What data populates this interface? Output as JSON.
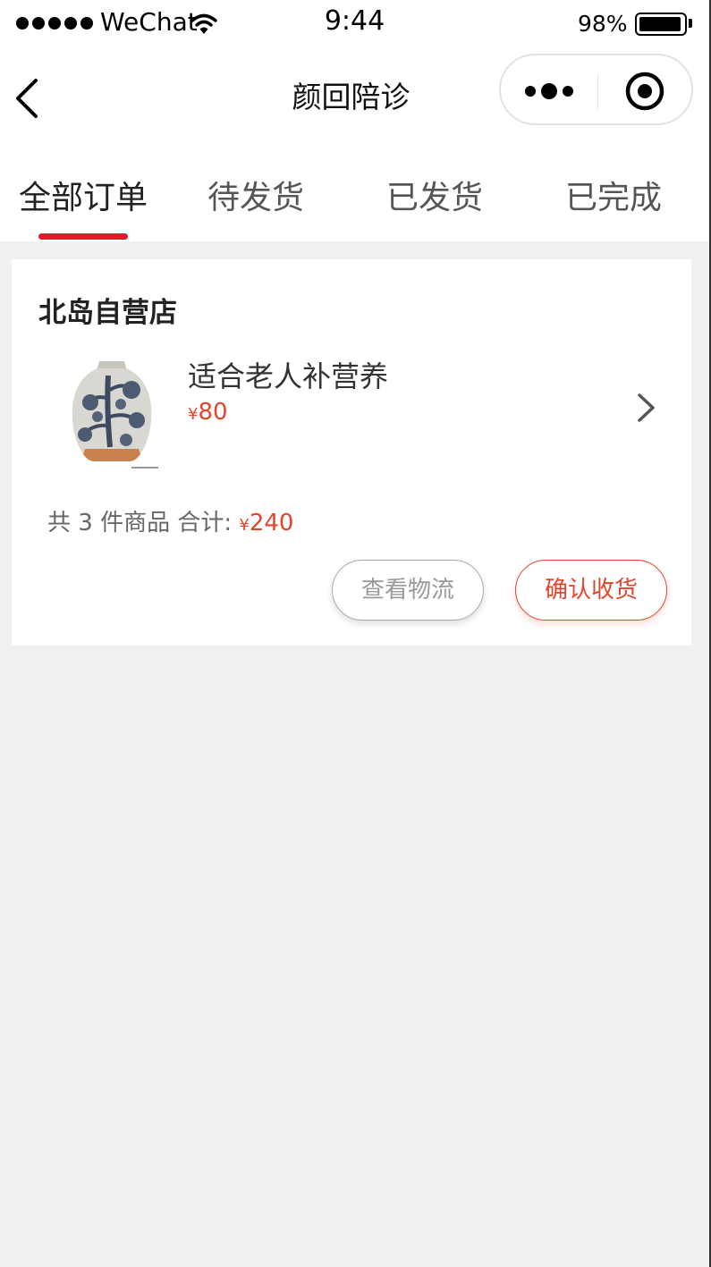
{
  "status_bar": {
    "carrier": "WeChat",
    "time": "9:44",
    "battery": "98%"
  },
  "nav": {
    "title": "颜回陪诊"
  },
  "tabs": [
    {
      "label": "全部订单",
      "active": true
    },
    {
      "label": "待发货",
      "active": false
    },
    {
      "label": "已发货",
      "active": false
    },
    {
      "label": "已完成",
      "active": false
    }
  ],
  "order": {
    "store_name": "北岛自营店",
    "product": {
      "name": "适合老人补营养",
      "currency": "¥",
      "price": "80"
    },
    "summary": {
      "text": "共 3 件商品 合计:",
      "currency": "¥",
      "total": "240"
    },
    "buttons": {
      "logistics": "查看物流",
      "confirm": "确认收货"
    }
  },
  "colors": {
    "accent_red": "#e8172a",
    "price_red": "#e3452c",
    "background": "#f0f0f0"
  }
}
